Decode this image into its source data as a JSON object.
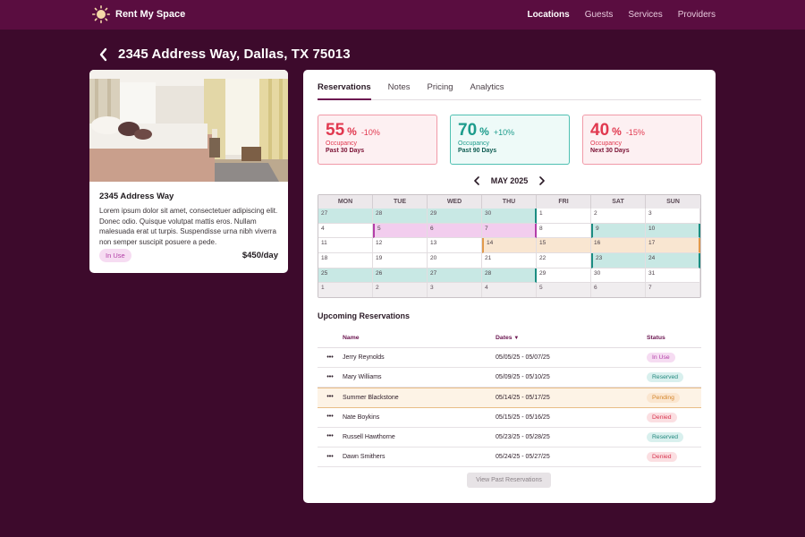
{
  "brand": {
    "name": "Rent My Space"
  },
  "nav": [
    "Locations",
    "Guests",
    "Services",
    "Providers"
  ],
  "page": {
    "title": "2345 Address Way, Dallas, TX 75013"
  },
  "property": {
    "name": "2345 Address Way",
    "description": "Lorem ipsum dolor sit amet, consectetuer adipiscing elit. Donec odio. Quisque volutpat mattis eros. Nullam malesuada erat ut turpis. Suspendisse urna nibh viverra non semper suscipit posuere a pede.",
    "status": "In Use",
    "price": "$450/day"
  },
  "tabs": [
    "Reservations",
    "Notes",
    "Pricing",
    "Analytics"
  ],
  "stats": [
    {
      "value": "55",
      "pct": "%",
      "delta": "-10%",
      "label": "Occupancy",
      "period": "Past 30 Days",
      "tone": "red"
    },
    {
      "value": "70",
      "pct": "%",
      "delta": "+10%",
      "label": "Occupancy",
      "period": "Past 90 Days",
      "tone": "teal"
    },
    {
      "value": "40",
      "pct": "%",
      "delta": "-15%",
      "label": "Occupancy",
      "period": "Next 30 Days",
      "tone": "red"
    }
  ],
  "calendar": {
    "month": "MAY 2025",
    "weekdays": [
      "MON",
      "TUE",
      "WED",
      "THU",
      "FRI",
      "SAT",
      "SUN"
    ],
    "days": [
      {
        "d": "27",
        "other": true,
        "fill": "teal"
      },
      {
        "d": "28",
        "other": true,
        "fill": "teal"
      },
      {
        "d": "29",
        "other": true,
        "fill": "teal"
      },
      {
        "d": "30",
        "other": true,
        "fill": "teal",
        "br": "teal"
      },
      {
        "d": "1"
      },
      {
        "d": "2"
      },
      {
        "d": "3"
      },
      {
        "d": "4"
      },
      {
        "d": "5",
        "fill": "pink",
        "bl": "pink"
      },
      {
        "d": "6",
        "fill": "pink"
      },
      {
        "d": "7",
        "fill": "pink",
        "br": "pink"
      },
      {
        "d": "8"
      },
      {
        "d": "9",
        "fill": "teal",
        "bl": "teal"
      },
      {
        "d": "10",
        "fill": "teal",
        "br": "teal"
      },
      {
        "d": "11"
      },
      {
        "d": "12"
      },
      {
        "d": "13"
      },
      {
        "d": "14",
        "fill": "peach",
        "bl": "peach"
      },
      {
        "d": "15",
        "fill": "peach"
      },
      {
        "d": "16",
        "fill": "peach"
      },
      {
        "d": "17",
        "fill": "peach",
        "br": "peach"
      },
      {
        "d": "18"
      },
      {
        "d": "19"
      },
      {
        "d": "20"
      },
      {
        "d": "21"
      },
      {
        "d": "22"
      },
      {
        "d": "23",
        "fill": "teal",
        "bl": "teal"
      },
      {
        "d": "24",
        "fill": "teal",
        "br": "teal"
      },
      {
        "d": "25",
        "fill": "teal"
      },
      {
        "d": "26",
        "fill": "teal"
      },
      {
        "d": "27",
        "fill": "teal"
      },
      {
        "d": "28",
        "fill": "teal",
        "br": "teal"
      },
      {
        "d": "29"
      },
      {
        "d": "30"
      },
      {
        "d": "31"
      },
      {
        "d": "1",
        "other": true
      },
      {
        "d": "2",
        "other": true
      },
      {
        "d": "3",
        "other": true
      },
      {
        "d": "4",
        "other": true
      },
      {
        "d": "5",
        "other": true
      },
      {
        "d": "6",
        "other": true
      },
      {
        "d": "7",
        "other": true
      }
    ]
  },
  "reservations": {
    "title": "Upcoming Reservations",
    "columns": {
      "name": "Name",
      "dates": "Dates",
      "status": "Status"
    },
    "rows": [
      {
        "name": "Jerry Reynolds",
        "dates": "05/05/25 - 05/07/25",
        "status": "In Use",
        "tone": "inuse"
      },
      {
        "name": "Mary Williams",
        "dates": "05/09/25 - 05/10/25",
        "status": "Reserved",
        "tone": "reserved"
      },
      {
        "name": "Summer Blackstone",
        "dates": "05/14/25 - 05/17/25",
        "status": "Pending",
        "tone": "pending",
        "highlight": true
      },
      {
        "name": "Nate Boykins",
        "dates": "05/15/25 - 05/16/25",
        "status": "Denied",
        "tone": "denied"
      },
      {
        "name": "Russell Hawthorne",
        "dates": "05/23/25 - 05/28/25",
        "status": "Reserved",
        "tone": "reserved"
      },
      {
        "name": "Dawn Smithers",
        "dates": "05/24/25 - 05/27/25",
        "status": "Denied",
        "tone": "denied"
      }
    ],
    "past_button": "View Past Reservations"
  },
  "colors": {
    "background": "#3d0a2c",
    "nav": "#5a0d40",
    "accent": "#6b1550",
    "teal": "#1d9c8c",
    "red": "#e1384f"
  }
}
